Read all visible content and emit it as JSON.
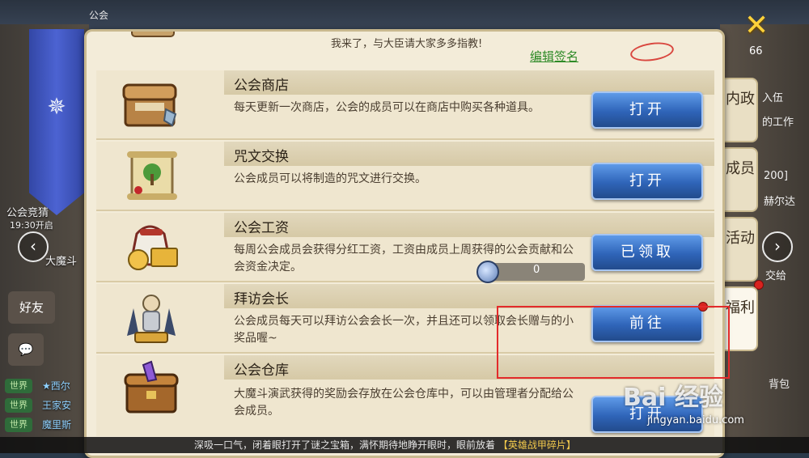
{
  "hud": {
    "top_label": "公会",
    "left_labels": [
      "公会竞猜",
      "19:30开启",
      "大魔斗"
    ],
    "friends_button": "好友",
    "chat_channels": [
      "世界",
      "世界",
      "世界"
    ],
    "chat_names": [
      "★西尔",
      "王家安",
      "魔里斯"
    ],
    "level": "66",
    "right_labels": [
      "入伍",
      "的工作",
      "200]",
      "赫尔达",
      "交给",
      "背包"
    ]
  },
  "panel": {
    "top_partial_text": "我来了，与大臣请大家多多指教!",
    "edit_signature": "编辑签名",
    "rows": [
      {
        "title": "公会商店",
        "desc": "每天更新一次商店，公会的成员可以在商店中购买各种道具。",
        "button": "打开",
        "icon": "treasure-chest-shop-icon"
      },
      {
        "title": "咒文交换",
        "desc": "公会成员可以将制造的咒文进行交换。",
        "button": "打开",
        "icon": "scroll-icon"
      },
      {
        "title": "公会工资",
        "desc": "每周公会成员会获得分红工资，工资由成员上周获得的公会贡献和公会资金决定。",
        "button": "已领取",
        "icon": "coin-bag-icon",
        "coin_value": "0"
      },
      {
        "title": "拜访会长",
        "desc": "公会成员每天可以拜访公会会长一次，并且还可以领取会长赠与的小奖品喔~",
        "button": "前往",
        "icon": "leader-statue-icon"
      },
      {
        "title": "公会仓库",
        "desc": "大魔斗演武获得的奖励会存放在公会仓库中，可以由管理者分配给公会成员。",
        "button": "打开",
        "icon": "storage-chest-icon"
      }
    ]
  },
  "tabs": [
    {
      "label": "内政"
    },
    {
      "label": "成员"
    },
    {
      "label": "活动"
    },
    {
      "label": "福利"
    }
  ],
  "bottom": {
    "ticker": "深吸一口气，闭着眼打开了谜之宝箱，满怀期待地睁开眼时，眼前放着",
    "highlight_tag": "【英雄战甲碎片】"
  },
  "watermark": {
    "main": "Bai 经验",
    "sub": "jingyan.baidu.com"
  },
  "colors": {
    "button_blue": "#2f64b8",
    "panel_bg": "#f3ecd9",
    "highlight_red": "#e32b2b",
    "link_green": "#2e8a27"
  }
}
